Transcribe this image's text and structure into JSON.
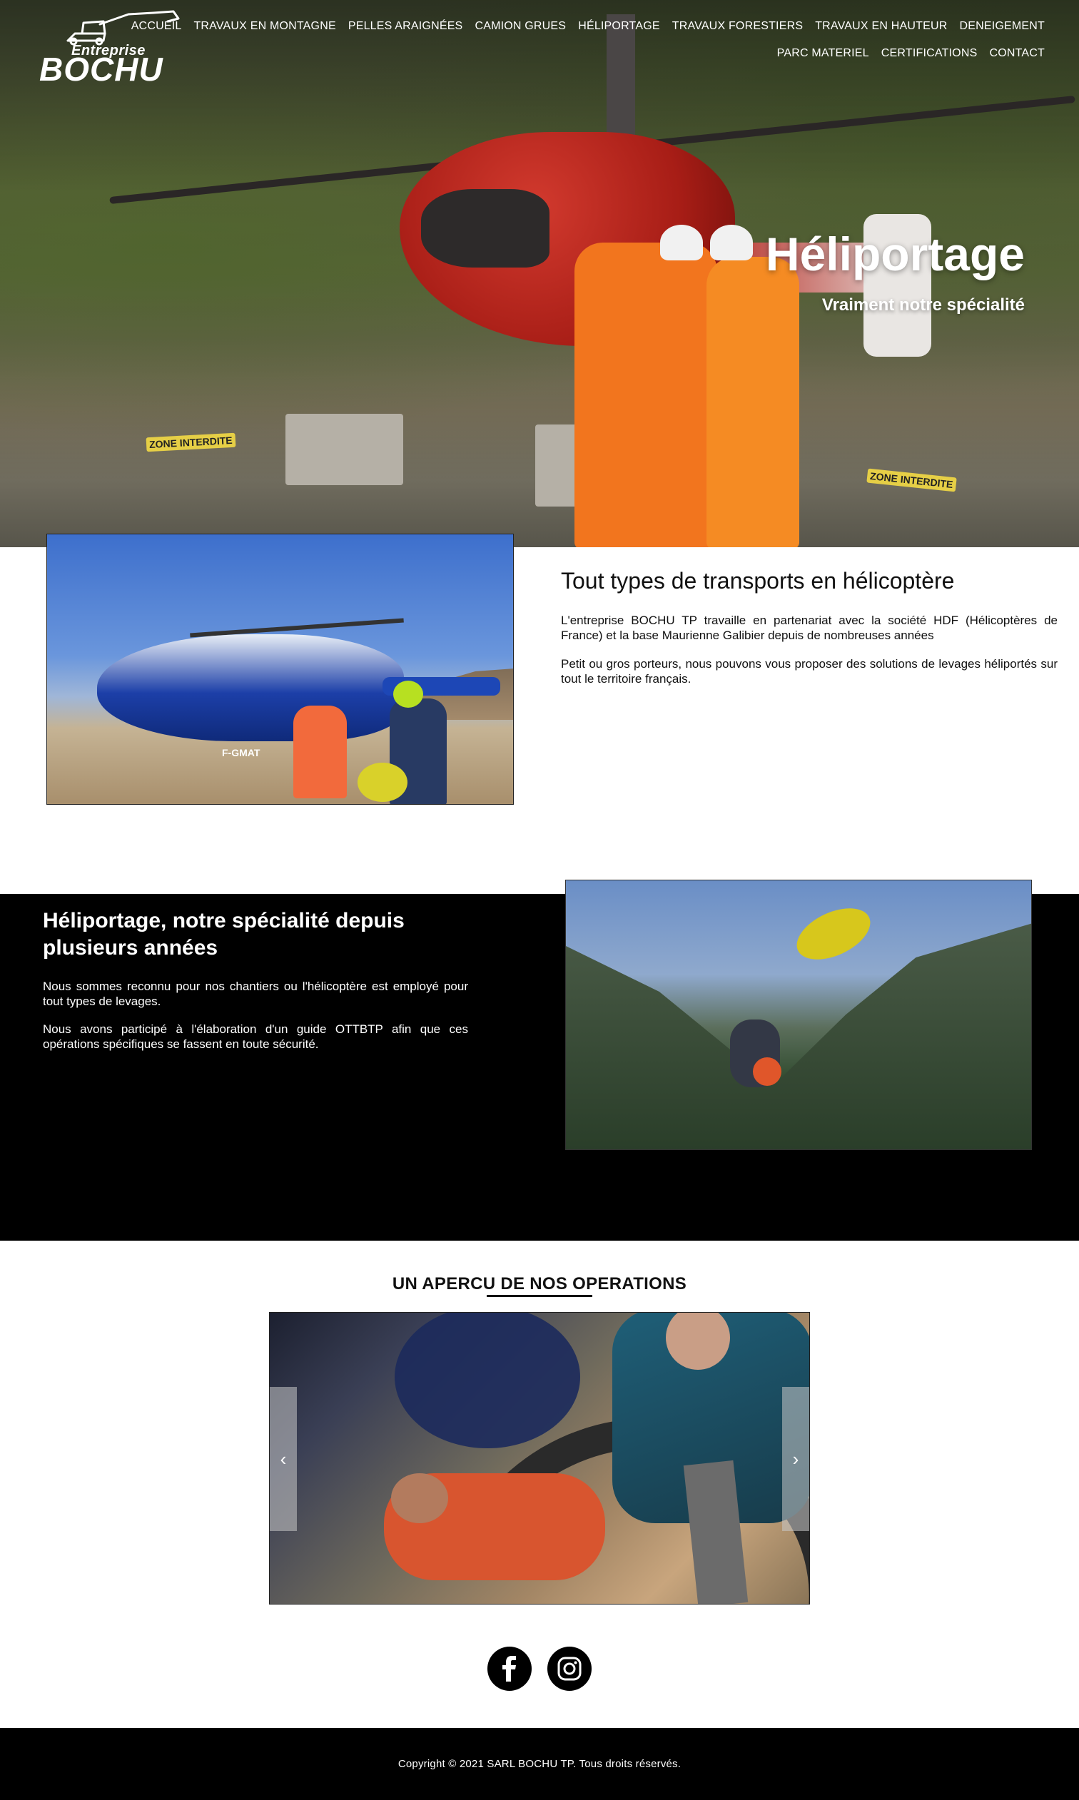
{
  "brand": {
    "logo_small": "Entreprise",
    "logo_big": "BOCHU"
  },
  "nav": {
    "row1": [
      "ACCUEIL",
      "TRAVAUX EN MONTAGNE",
      "PELLES ARAIGNÉES",
      "CAMION GRUES",
      "HÉLIPORTAGE",
      "TRAVAUX FORESTIERS",
      "TRAVAUX EN HAUTEUR",
      "DENEIGEMENT"
    ],
    "row2": [
      "PARC MATERIEL",
      "CERTIFICATIONS",
      "CONTACT"
    ]
  },
  "hero": {
    "title": "Héliportage",
    "subtitle": "Vraiment notre spécialité",
    "signs": [
      "ZONE INTERDITE",
      "ZONE INTERDITE"
    ]
  },
  "section1": {
    "image_label": "F-GMAT",
    "title": "Tout types de transports en hélicoptère",
    "p1": "L'entreprise BOCHU TP travaille en partenariat avec la société HDF (Hélicoptères de France) et la base Maurienne Galibier depuis de nombreuses années",
    "p2": "Petit ou gros porteurs, nous pouvons vous proposer des solutions de levages héliportés sur tout le territoire français."
  },
  "section2": {
    "title": "Héliportage, notre spécialité depuis plusieurs années",
    "p1": "Nous sommes reconnu pour nos chantiers ou l'hélicoptère est employé pour tout types de levages.",
    "p2": "Nous avons participé à l'élaboration d'un guide OTTBTP afin que ces opérations spécifiques se fassent en toute sécurité."
  },
  "operations": {
    "title": "UN APERCU DE NOS OPERATIONS",
    "prev": "‹",
    "next": "›"
  },
  "social": {
    "icons": [
      "facebook-icon",
      "instagram-icon"
    ]
  },
  "footer": {
    "copyright": "Copyright © 2021 SARL BOCHU TP. Tous droits réservés."
  },
  "colors": {
    "dark_section": "#000000",
    "footer": "#000000",
    "text": "#111111"
  }
}
